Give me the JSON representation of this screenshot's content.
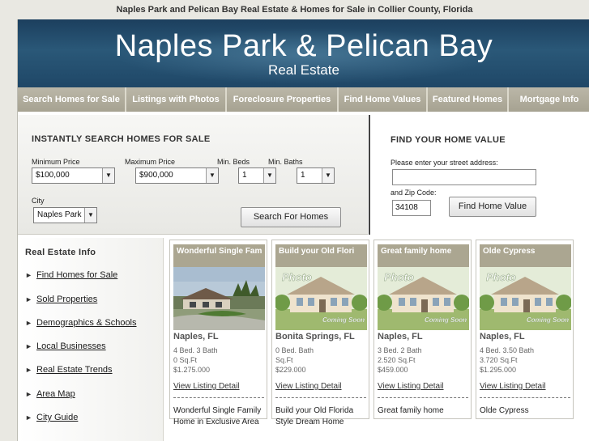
{
  "page": {
    "top_title": "Naples Park and Pelican Bay Real Estate & Homes for Sale in Collier County, Florida"
  },
  "banner": {
    "title": "Naples Park & Pelican Bay",
    "subtitle": "Real Estate"
  },
  "nav": {
    "items": [
      {
        "label": "Search Homes for Sale"
      },
      {
        "label": "Listings with Photos"
      },
      {
        "label": "Foreclosure Properties"
      },
      {
        "label": "Find Home Values"
      },
      {
        "label": "Featured Homes"
      },
      {
        "label": "Mortgage Info"
      }
    ]
  },
  "search": {
    "title": "INSTANTLY SEARCH HOMES FOR SALE",
    "min_price_label": "Minimum Price",
    "min_price_value": "$100,000",
    "max_price_label": "Maximum Price",
    "max_price_value": "$900,000",
    "min_beds_label": "Min. Beds",
    "min_beds_value": "1",
    "min_baths_label": "Min. Baths",
    "min_baths_value": "1",
    "city_label": "City",
    "city_value": "Naples Park",
    "button_label": "Search For Homes"
  },
  "home_value": {
    "title": "FIND YOUR HOME VALUE",
    "address_label": "Please enter your street address:",
    "address_value": "",
    "zip_label": "and Zip Code:",
    "zip_value": "34108",
    "button_label": "Find Home Value"
  },
  "sidebar": {
    "title": "Real Estate Info",
    "items": [
      {
        "label": "Find Homes for Sale"
      },
      {
        "label": "Sold Properties"
      },
      {
        "label": "Demographics & Schools"
      },
      {
        "label": "Local Businesses"
      },
      {
        "label": "Real Estate Trends"
      },
      {
        "label": "Area Map"
      },
      {
        "label": "City Guide"
      }
    ]
  },
  "listings": [
    {
      "headline": "Wonderful Single Fam",
      "city": "Naples, FL",
      "beds_baths": "4 Bed. 3 Bath",
      "sqft": "0 Sq.Ft",
      "price": "$1.275.000",
      "detail_link": "View Listing Detail",
      "description": "Wonderful Single Family Home in Exclusive Area",
      "photo": "house-photo"
    },
    {
      "headline": "Build your Old Flori",
      "city": "Bonita Springs, FL",
      "beds_baths": "0 Bed. Bath",
      "sqft": "Sq.Ft",
      "price": "$229.000",
      "detail_link": "View Listing Detail",
      "description": "Build your Old Florida Style Dream Home",
      "photo": "photo-coming-soon"
    },
    {
      "headline": "Great family home",
      "city": "Naples, FL",
      "beds_baths": "3 Bed. 2 Bath",
      "sqft": "2.520 Sq.Ft",
      "price": "$459.000",
      "detail_link": "View Listing Detail",
      "description": "Great family home",
      "photo": "photo-coming-soon"
    },
    {
      "headline": "Olde Cypress",
      "city": "Naples, FL",
      "beds_baths": "4 Bed. 3.50 Bath",
      "sqft": "3.720 Sq.Ft",
      "price": "$1.295.000",
      "detail_link": "View Listing Detail",
      "description": "Olde Cypress",
      "photo": "photo-coming-soon"
    }
  ],
  "photo_placeholder": {
    "top_text": "Photo",
    "bottom_text": "Coming Soon"
  },
  "colors": {
    "banner_blue": "#1f4767",
    "nav_tan": "#a6a291",
    "card_header": "#aba691"
  }
}
